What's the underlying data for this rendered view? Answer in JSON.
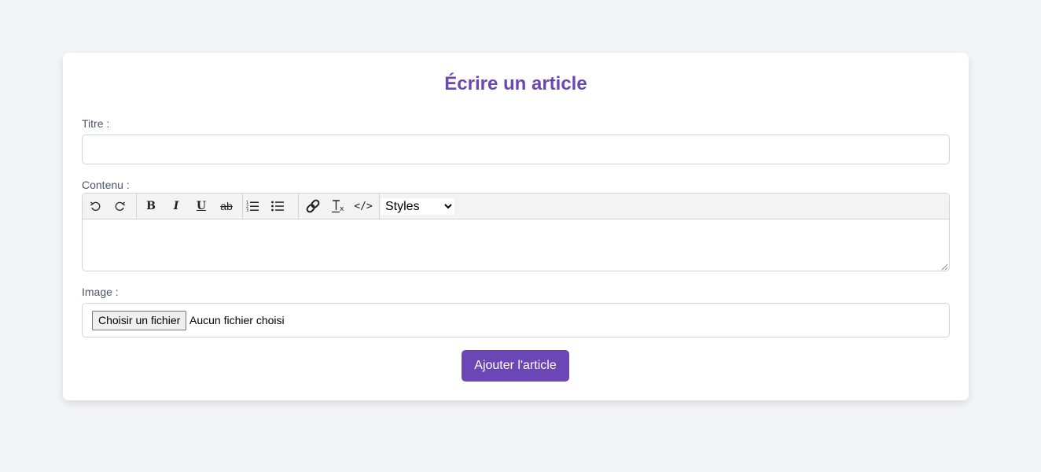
{
  "form": {
    "title": "Écrire un article",
    "title_field": {
      "label": "Titre :",
      "value": ""
    },
    "content_field": {
      "label": "Contenu :",
      "value": ""
    },
    "image_field": {
      "label": "Image :",
      "button_label": "Choisir un fichier",
      "status": "Aucun fichier choisi"
    },
    "submit_label": "Ajouter l'article"
  },
  "toolbar": {
    "buttons": [
      {
        "name": "undo-icon"
      },
      {
        "name": "redo-icon"
      },
      {
        "name": "bold-icon",
        "glyph": "B"
      },
      {
        "name": "italic-icon",
        "glyph": "I"
      },
      {
        "name": "underline-icon",
        "glyph": "U"
      },
      {
        "name": "strikethrough-icon",
        "glyph": "ab"
      },
      {
        "name": "ordered-list-icon"
      },
      {
        "name": "bullet-list-icon"
      },
      {
        "name": "link-icon"
      },
      {
        "name": "clear-format-icon"
      },
      {
        "name": "code-icon",
        "glyph": "</>"
      }
    ],
    "styles_select": {
      "selected": "Styles"
    }
  },
  "colors": {
    "accent": "#6b46b5",
    "background": "#f3f4f6",
    "card": "#ffffff",
    "border": "#d1d5db",
    "label_text": "#4b5563"
  }
}
